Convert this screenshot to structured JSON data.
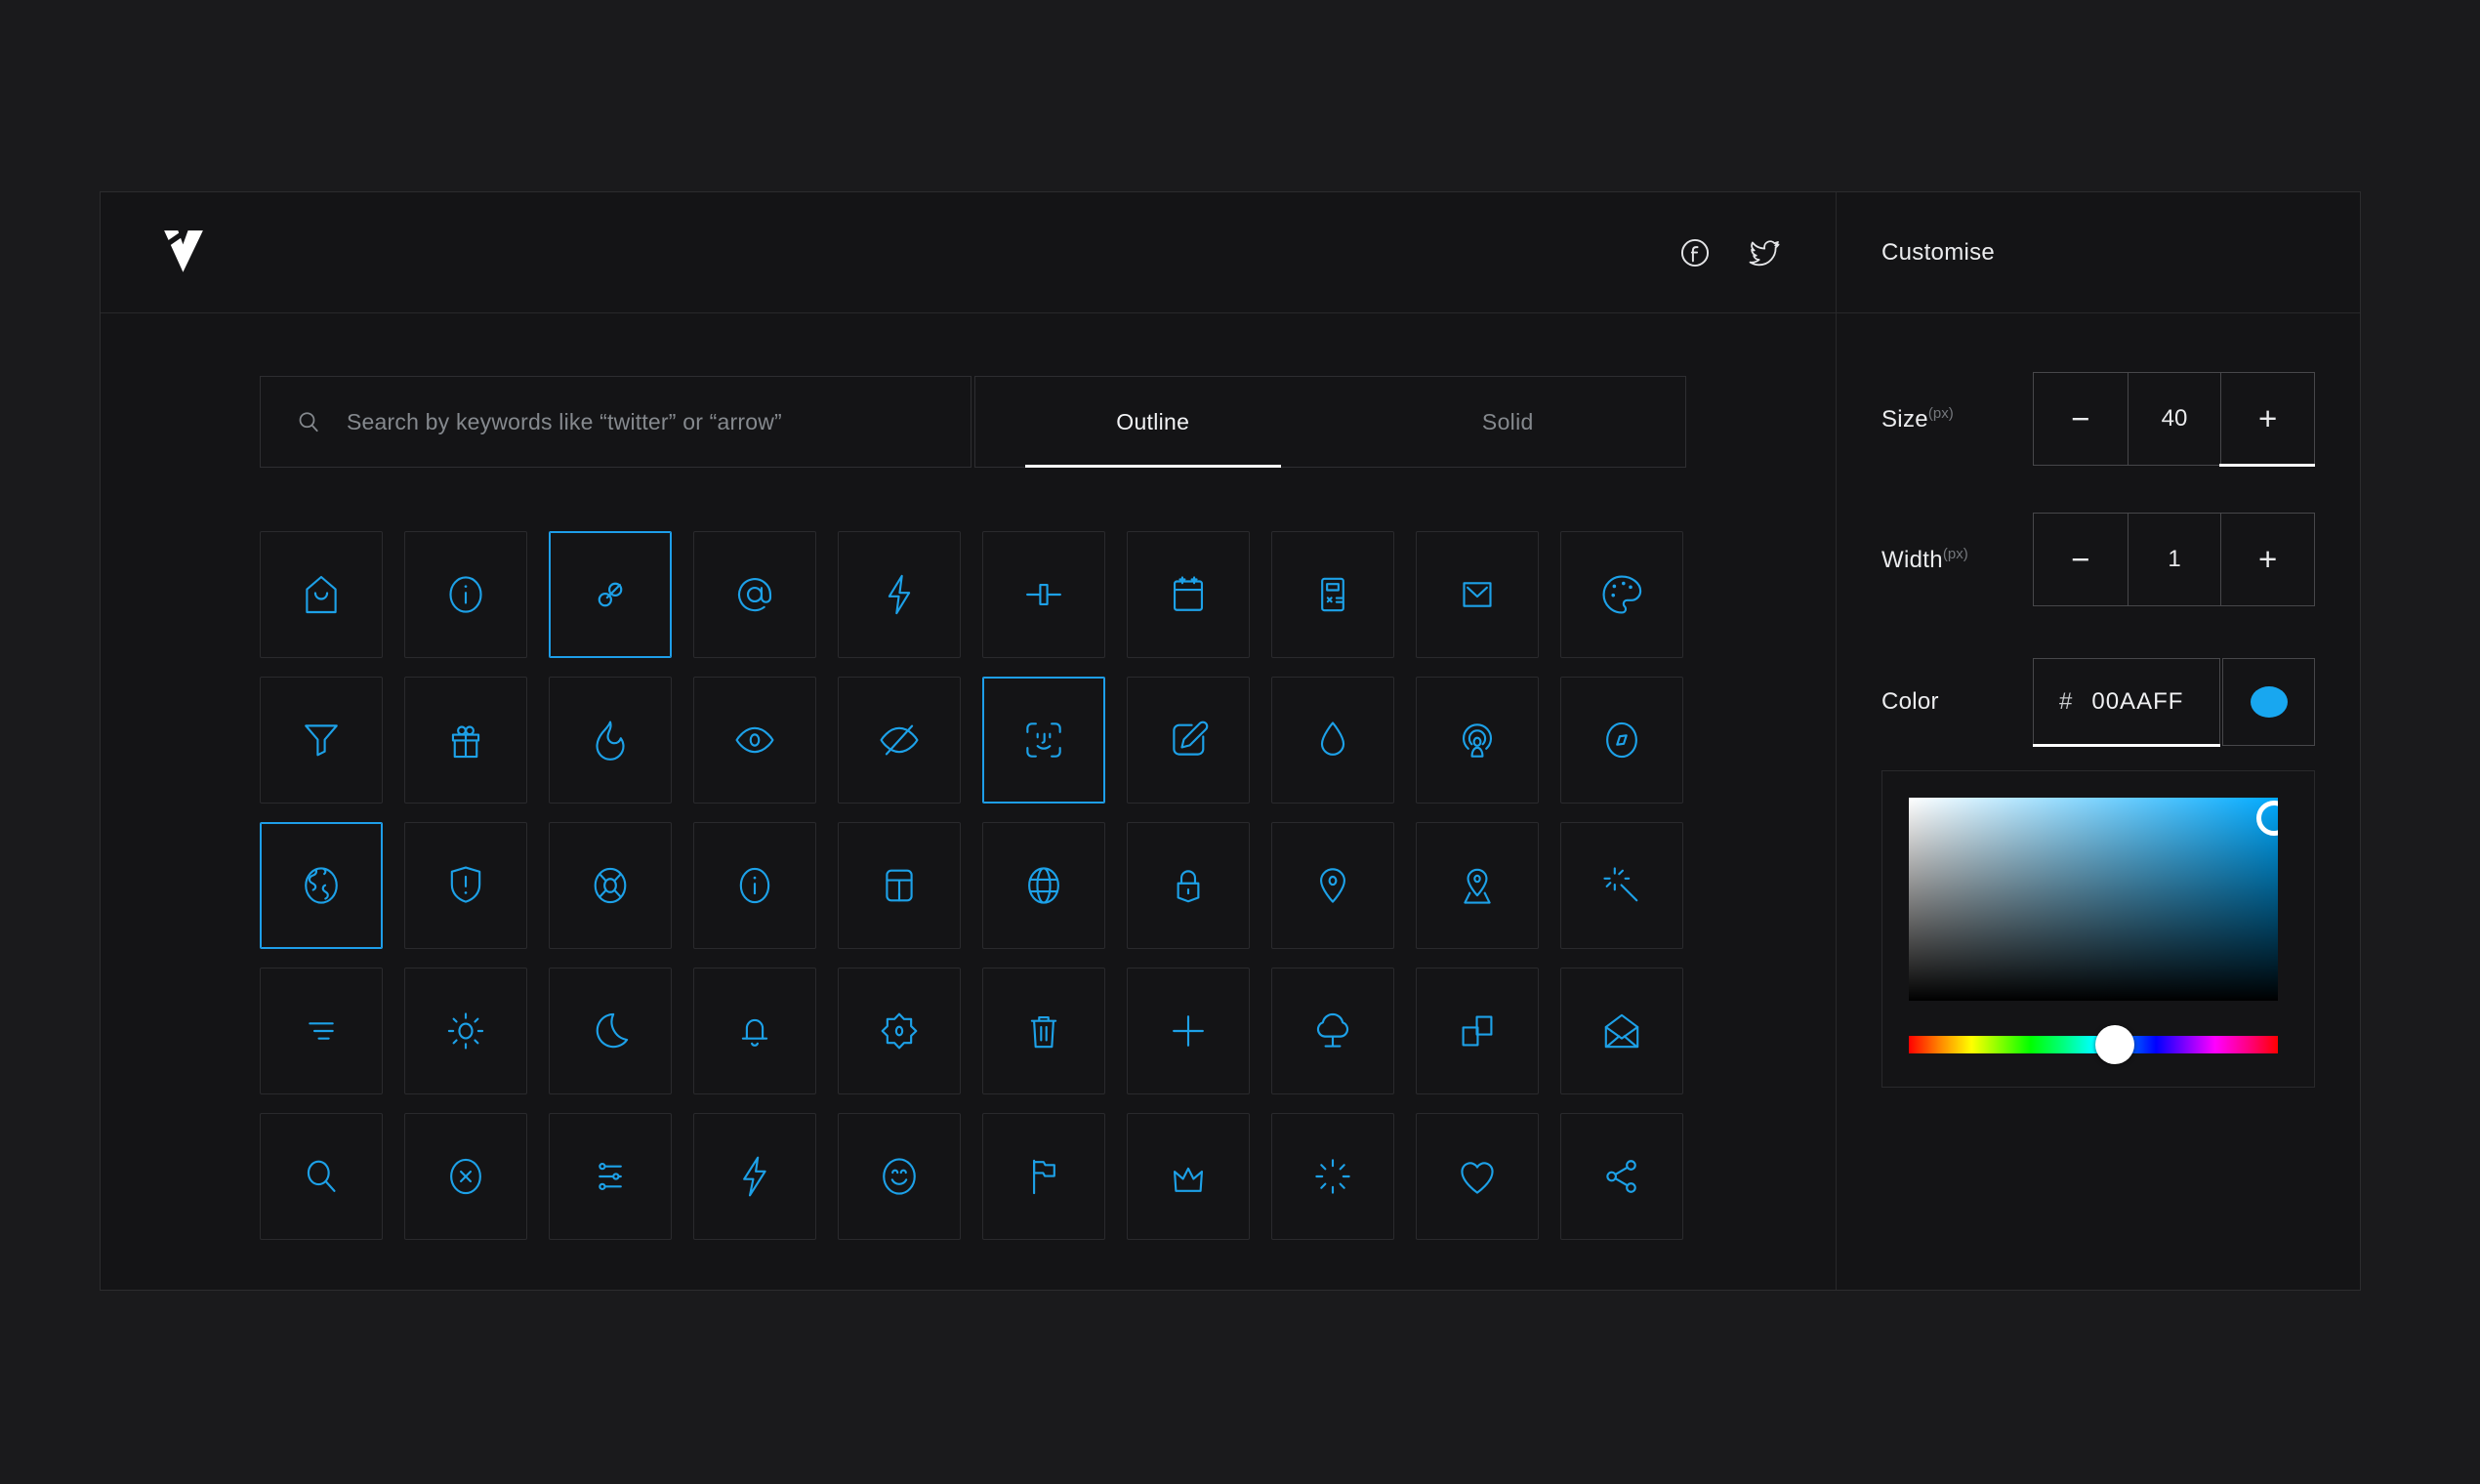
{
  "header": {
    "logo": "vivid-logo",
    "social": {
      "facebook": "facebook",
      "twitter": "twitter"
    }
  },
  "search": {
    "placeholder": "Search by keywords like “twitter” or “arrow”"
  },
  "tabs": [
    {
      "label": "Outline",
      "active": true
    },
    {
      "label": "Solid",
      "active": false
    }
  ],
  "panel": {
    "title": "Customise",
    "size": {
      "label": "Size",
      "unit": "(px)",
      "minus": "−",
      "value": "40",
      "plus": "+"
    },
    "width": {
      "label": "Width",
      "unit": "(px)",
      "minus": "−",
      "value": "1",
      "plus": "+"
    },
    "color": {
      "label": "Color",
      "hash": "#",
      "value": "00AAFF",
      "swatch_color": "#18a7f0"
    },
    "picker": {
      "gradient_color": "#00AAFF",
      "hue_position_percent": 55.7
    }
  },
  "icons": {
    "stroke": "#1da1e8",
    "selected_border": "#1e9ee9",
    "items": [
      {
        "name": "home"
      },
      {
        "name": "info-circle"
      },
      {
        "name": "link",
        "selected": true
      },
      {
        "name": "at-sign"
      },
      {
        "name": "bolt"
      },
      {
        "name": "connector"
      },
      {
        "name": "calendar"
      },
      {
        "name": "calculator"
      },
      {
        "name": "mail-square"
      },
      {
        "name": "palette"
      },
      {
        "name": "filter"
      },
      {
        "name": "gift"
      },
      {
        "name": "flame"
      },
      {
        "name": "eye"
      },
      {
        "name": "eye-off"
      },
      {
        "name": "face-id",
        "selected": true
      },
      {
        "name": "edit"
      },
      {
        "name": "droplet"
      },
      {
        "name": "podcast"
      },
      {
        "name": "compass"
      },
      {
        "name": "earth",
        "selected": true
      },
      {
        "name": "shield-alert"
      },
      {
        "name": "lifebuoy"
      },
      {
        "name": "info-oval"
      },
      {
        "name": "layout-top"
      },
      {
        "name": "globe"
      },
      {
        "name": "lock"
      },
      {
        "name": "map-pin"
      },
      {
        "name": "map-pin-area"
      },
      {
        "name": "magic-wand"
      },
      {
        "name": "sort-lines"
      },
      {
        "name": "sun"
      },
      {
        "name": "moon"
      },
      {
        "name": "bell"
      },
      {
        "name": "badge"
      },
      {
        "name": "trash"
      },
      {
        "name": "plus"
      },
      {
        "name": "tree"
      },
      {
        "name": "copy"
      },
      {
        "name": "mail-open"
      },
      {
        "name": "search"
      },
      {
        "name": "x-circle"
      },
      {
        "name": "sliders"
      },
      {
        "name": "lightning"
      },
      {
        "name": "smile"
      },
      {
        "name": "flag"
      },
      {
        "name": "crown"
      },
      {
        "name": "spinner"
      },
      {
        "name": "heart"
      },
      {
        "name": "share"
      }
    ]
  }
}
